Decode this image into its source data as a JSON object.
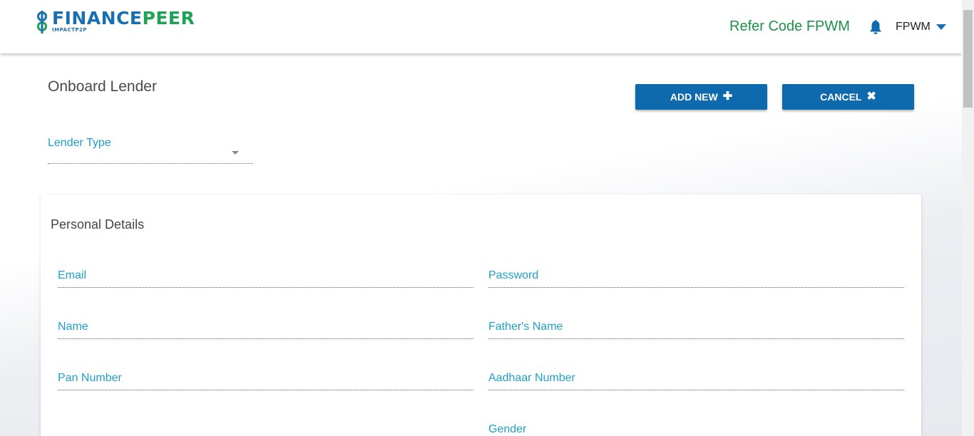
{
  "header": {
    "logo": {
      "word_part1": "FINANCE",
      "word_part2": "PEER",
      "tagline": "IMPACTP2P"
    },
    "refer_code_text": "Refer Code FPWM",
    "bell_icon": "bell-icon",
    "user_name": "FPWM"
  },
  "page": {
    "title": "Onboard Lender",
    "add_new_label": "ADD NEW",
    "cancel_label": "CANCEL",
    "lender_type_label": "Lender Type"
  },
  "personal_details": {
    "title": "Personal Details",
    "fields": {
      "email": "Email",
      "password": "Password",
      "name": "Name",
      "fathers_name": "Father's Name",
      "pan_number": "Pan Number",
      "aadhaar_number": "Aadhaar Number",
      "gender": "Gender"
    }
  },
  "colors": {
    "brand_blue": "#0f6aad",
    "brand_green": "#1e9148",
    "label_cyan": "#1fa0c6"
  }
}
